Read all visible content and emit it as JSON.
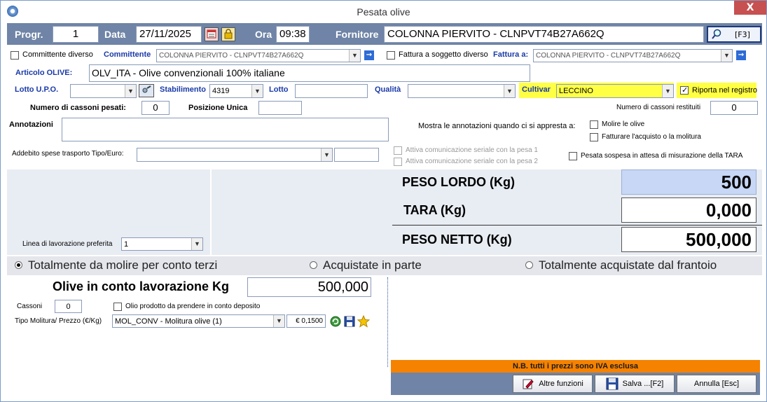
{
  "window": {
    "title": "Pesata olive",
    "close_label": "X"
  },
  "header": {
    "progr_label": "Progr.",
    "progr_value": "1",
    "data_label": "Data",
    "data_value": "27/11/2025",
    "ora_label": "Ora",
    "ora_value": "09:38",
    "fornitore_label": "Fornitore",
    "fornitore_value": "COLONNA PIERVITO - CLNPVT74B27A662Q",
    "f3_label": "[F3]"
  },
  "row1": {
    "committente_diverso_label": "Committente diverso",
    "committente_label": "Committente",
    "committente_value": "COLONNA PIERVITO - CLNPVT74B27A662Q",
    "fattura_soggetto_label": "Fattura a soggetto diverso",
    "fattura_a_label": "Fattura a:",
    "fattura_a_value": "COLONNA PIERVITO - CLNPVT74B27A662Q"
  },
  "articolo": {
    "label": "Articolo OLIVE:",
    "value": "OLV_ITA -  Olive convenzionali 100% italiane"
  },
  "row3": {
    "lotto_upo_label": "Lotto U.P.O.",
    "lotto_upo_value": "",
    "stabilimento_label": "Stabilimento",
    "stabilimento_value": "4319",
    "lotto_label": "Lotto",
    "lotto_value": "",
    "qualita_label": "Qualità",
    "qualita_value": "",
    "cultivar_label": "Cultivar",
    "cultivar_value": "LECCINO",
    "riporta_label": "Riporta nel registro"
  },
  "row4": {
    "cassoni_pesati_label": "Numero di cassoni pesati:",
    "cassoni_pesati_value": "0",
    "posizione_label": "Posizione Unica",
    "posizione_value": "",
    "cassoni_restituiti_label": "Numero di cassoni restituiti",
    "cassoni_restituiti_value": "0"
  },
  "annotazioni": {
    "label": "Annotazioni",
    "value": "",
    "mostra_label": "Mostra le annotazioni quando ci si appresta a:",
    "molire_label": "Molire le olive",
    "fatturare_label": "Fatturare l'acquisto o la molitura"
  },
  "addebito": {
    "label": "Addebito spese trasporto Tipo/Euro:",
    "tipo_value": "",
    "euro_value": ""
  },
  "seriale": {
    "pesa1_label": "Attiva comunicazione seriale con la pesa 1",
    "pesa2_label": "Attiva comunicazione seriale con la pesa 2",
    "sospesa_label": "Pesata sospesa in attesa di misurazione della TARA"
  },
  "linea": {
    "label": "Linea di lavorazione preferita",
    "value": "1"
  },
  "pesi": {
    "lordo_label": "PESO LORDO (Kg)",
    "lordo_value": "500",
    "tara_label": "TARA (Kg)",
    "tara_value": "0,000",
    "netto_label": "PESO NETTO (Kg)",
    "netto_value": "500,000"
  },
  "radio_options": [
    {
      "label": "Totalmente da molire per conto terzi",
      "selected": true
    },
    {
      "label": "Acquistate in parte",
      "selected": false
    },
    {
      "label": "Totalmente acquistate dal frantoio",
      "selected": false
    }
  ],
  "lavorazione": {
    "olive_label": "Olive in conto lavorazione Kg",
    "olive_value": "500,000",
    "cassoni_label": "Cassoni",
    "cassoni_value": "0",
    "olio_deposito_label": "Olio prodotto da prendere in conto deposito",
    "tipo_molitura_label": "Tipo Molitura/ Prezzo (€/Kg)",
    "tipo_molitura_value": "MOL_CONV -  Molitura olive (1)",
    "prezzo_value": "€ 0,1500"
  },
  "footer": {
    "note": "N.B. tutti i prezzi sono IVA esclusa",
    "altre_funzioni_label": "Altre funzioni",
    "salva_label": "Salva ...[F2]",
    "annulla_label": "Annulla [Esc]"
  },
  "colors": {
    "header_bar": "#6f84a6",
    "cultivar_highlight": "#ffff44",
    "note_bar": "#f58200",
    "lordo_bg": "#c7d7f5"
  }
}
